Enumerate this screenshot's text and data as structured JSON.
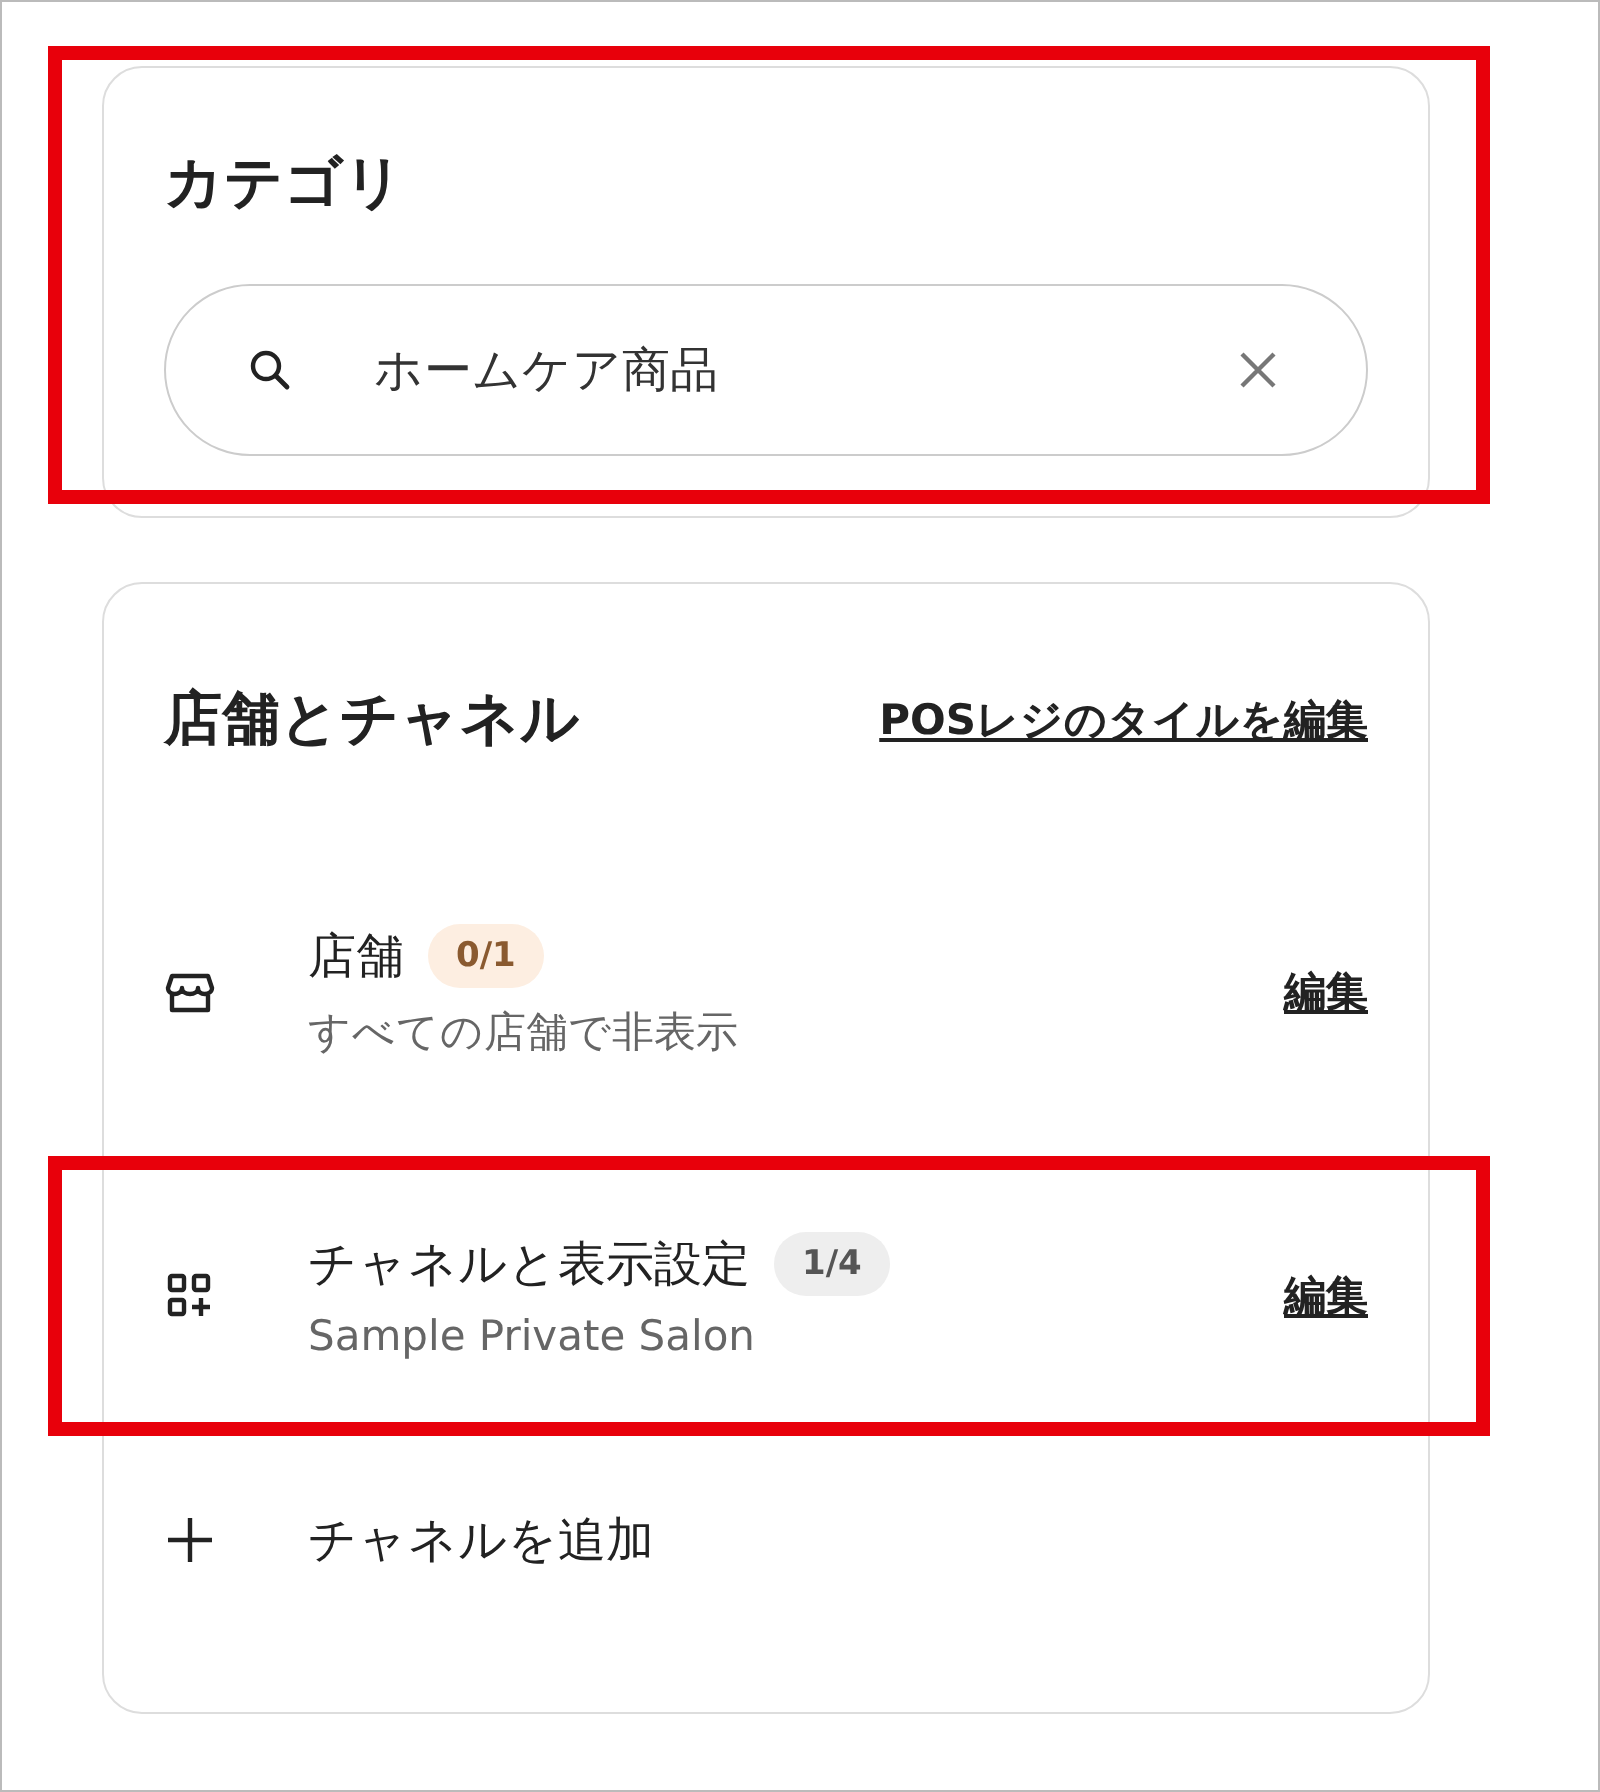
{
  "category": {
    "title": "カテゴリ",
    "search": {
      "value": "ホームケア商品"
    },
    "highlighted": true
  },
  "stores_channels": {
    "title": "店舗とチャネル",
    "edit_tiles_link": "POSレジのタイルを編集",
    "items": [
      {
        "kind": "store",
        "title": "店舗",
        "badge": "0/1",
        "color": "#fdeee1",
        "subtitle": "すべての店舗で非表示",
        "edit": "編集",
        "highlighted": false
      },
      {
        "kind": "channels",
        "title": "チャネルと表示設定",
        "badge": "1/4",
        "color": "#eeeeee",
        "subtitle": "Sample Private Salon",
        "edit": "編集",
        "highlighted": true
      }
    ],
    "add_channel": "チャネルを追加"
  }
}
